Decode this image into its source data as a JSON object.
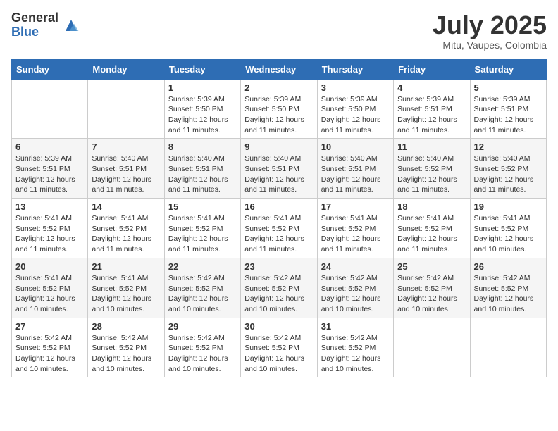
{
  "header": {
    "logo_general": "General",
    "logo_blue": "Blue",
    "month_title": "July 2025",
    "location": "Mitu, Vaupes, Colombia"
  },
  "days_of_week": [
    "Sunday",
    "Monday",
    "Tuesday",
    "Wednesday",
    "Thursday",
    "Friday",
    "Saturday"
  ],
  "weeks": [
    [
      {
        "num": "",
        "info": ""
      },
      {
        "num": "",
        "info": ""
      },
      {
        "num": "1",
        "info": "Sunrise: 5:39 AM\nSunset: 5:50 PM\nDaylight: 12 hours and 11 minutes."
      },
      {
        "num": "2",
        "info": "Sunrise: 5:39 AM\nSunset: 5:50 PM\nDaylight: 12 hours and 11 minutes."
      },
      {
        "num": "3",
        "info": "Sunrise: 5:39 AM\nSunset: 5:50 PM\nDaylight: 12 hours and 11 minutes."
      },
      {
        "num": "4",
        "info": "Sunrise: 5:39 AM\nSunset: 5:51 PM\nDaylight: 12 hours and 11 minutes."
      },
      {
        "num": "5",
        "info": "Sunrise: 5:39 AM\nSunset: 5:51 PM\nDaylight: 12 hours and 11 minutes."
      }
    ],
    [
      {
        "num": "6",
        "info": "Sunrise: 5:39 AM\nSunset: 5:51 PM\nDaylight: 12 hours and 11 minutes."
      },
      {
        "num": "7",
        "info": "Sunrise: 5:40 AM\nSunset: 5:51 PM\nDaylight: 12 hours and 11 minutes."
      },
      {
        "num": "8",
        "info": "Sunrise: 5:40 AM\nSunset: 5:51 PM\nDaylight: 12 hours and 11 minutes."
      },
      {
        "num": "9",
        "info": "Sunrise: 5:40 AM\nSunset: 5:51 PM\nDaylight: 12 hours and 11 minutes."
      },
      {
        "num": "10",
        "info": "Sunrise: 5:40 AM\nSunset: 5:51 PM\nDaylight: 12 hours and 11 minutes."
      },
      {
        "num": "11",
        "info": "Sunrise: 5:40 AM\nSunset: 5:52 PM\nDaylight: 12 hours and 11 minutes."
      },
      {
        "num": "12",
        "info": "Sunrise: 5:40 AM\nSunset: 5:52 PM\nDaylight: 12 hours and 11 minutes."
      }
    ],
    [
      {
        "num": "13",
        "info": "Sunrise: 5:41 AM\nSunset: 5:52 PM\nDaylight: 12 hours and 11 minutes."
      },
      {
        "num": "14",
        "info": "Sunrise: 5:41 AM\nSunset: 5:52 PM\nDaylight: 12 hours and 11 minutes."
      },
      {
        "num": "15",
        "info": "Sunrise: 5:41 AM\nSunset: 5:52 PM\nDaylight: 12 hours and 11 minutes."
      },
      {
        "num": "16",
        "info": "Sunrise: 5:41 AM\nSunset: 5:52 PM\nDaylight: 12 hours and 11 minutes."
      },
      {
        "num": "17",
        "info": "Sunrise: 5:41 AM\nSunset: 5:52 PM\nDaylight: 12 hours and 11 minutes."
      },
      {
        "num": "18",
        "info": "Sunrise: 5:41 AM\nSunset: 5:52 PM\nDaylight: 12 hours and 11 minutes."
      },
      {
        "num": "19",
        "info": "Sunrise: 5:41 AM\nSunset: 5:52 PM\nDaylight: 12 hours and 10 minutes."
      }
    ],
    [
      {
        "num": "20",
        "info": "Sunrise: 5:41 AM\nSunset: 5:52 PM\nDaylight: 12 hours and 10 minutes."
      },
      {
        "num": "21",
        "info": "Sunrise: 5:41 AM\nSunset: 5:52 PM\nDaylight: 12 hours and 10 minutes."
      },
      {
        "num": "22",
        "info": "Sunrise: 5:42 AM\nSunset: 5:52 PM\nDaylight: 12 hours and 10 minutes."
      },
      {
        "num": "23",
        "info": "Sunrise: 5:42 AM\nSunset: 5:52 PM\nDaylight: 12 hours and 10 minutes."
      },
      {
        "num": "24",
        "info": "Sunrise: 5:42 AM\nSunset: 5:52 PM\nDaylight: 12 hours and 10 minutes."
      },
      {
        "num": "25",
        "info": "Sunrise: 5:42 AM\nSunset: 5:52 PM\nDaylight: 12 hours and 10 minutes."
      },
      {
        "num": "26",
        "info": "Sunrise: 5:42 AM\nSunset: 5:52 PM\nDaylight: 12 hours and 10 minutes."
      }
    ],
    [
      {
        "num": "27",
        "info": "Sunrise: 5:42 AM\nSunset: 5:52 PM\nDaylight: 12 hours and 10 minutes."
      },
      {
        "num": "28",
        "info": "Sunrise: 5:42 AM\nSunset: 5:52 PM\nDaylight: 12 hours and 10 minutes."
      },
      {
        "num": "29",
        "info": "Sunrise: 5:42 AM\nSunset: 5:52 PM\nDaylight: 12 hours and 10 minutes."
      },
      {
        "num": "30",
        "info": "Sunrise: 5:42 AM\nSunset: 5:52 PM\nDaylight: 12 hours and 10 minutes."
      },
      {
        "num": "31",
        "info": "Sunrise: 5:42 AM\nSunset: 5:52 PM\nDaylight: 12 hours and 10 minutes."
      },
      {
        "num": "",
        "info": ""
      },
      {
        "num": "",
        "info": ""
      }
    ]
  ]
}
